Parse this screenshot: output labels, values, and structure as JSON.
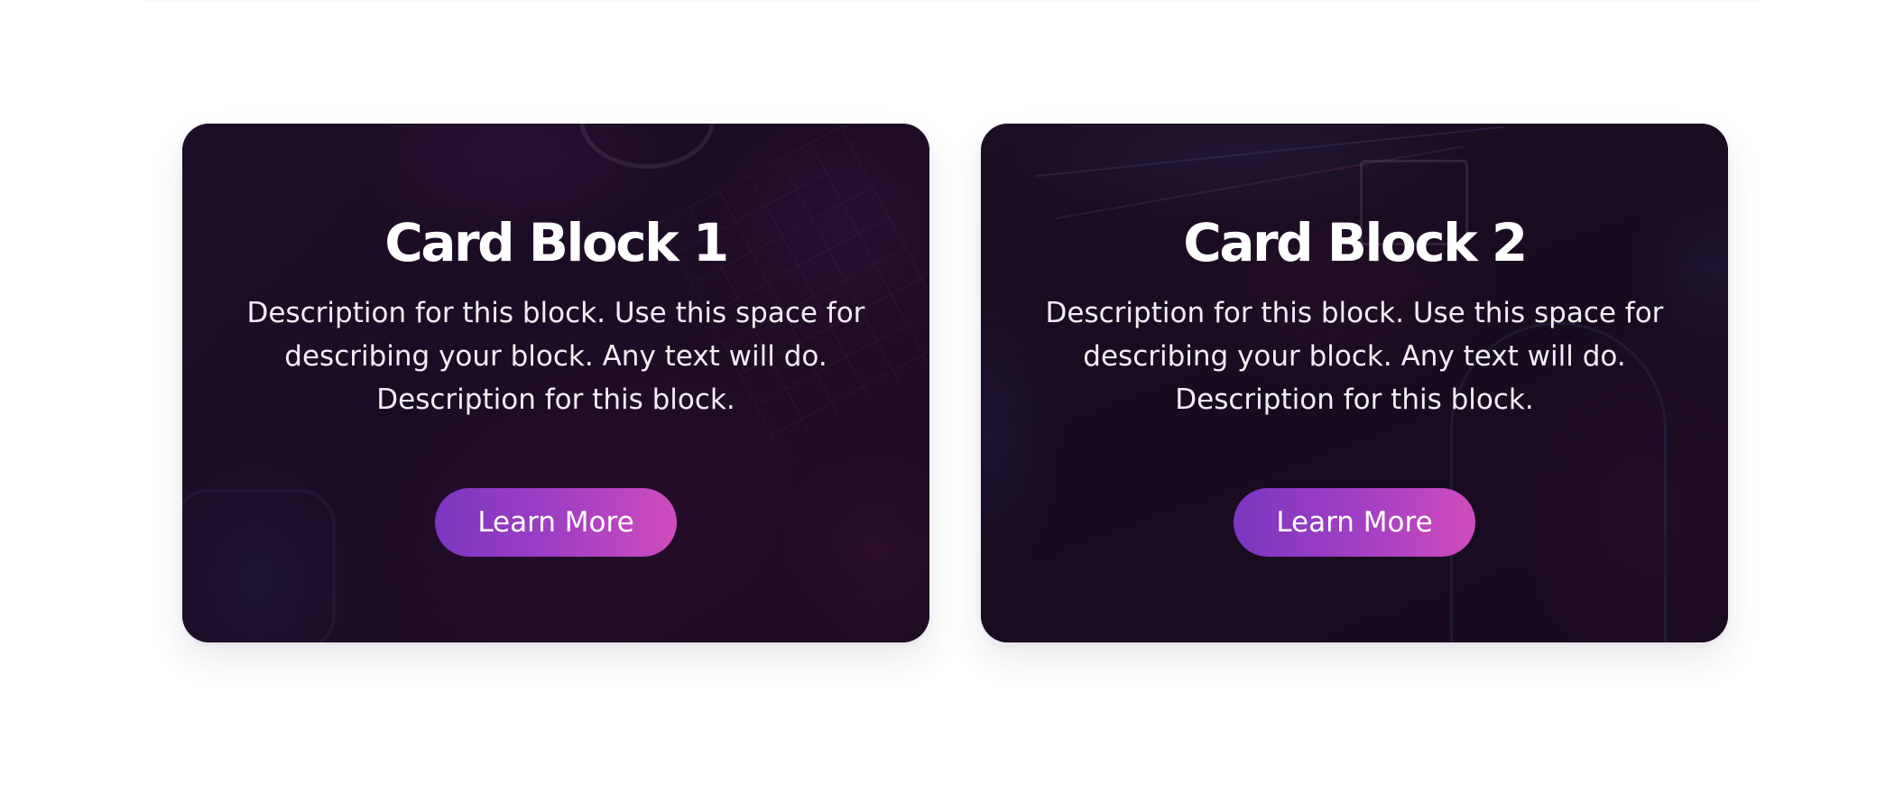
{
  "cards": [
    {
      "title": "Card Block 1",
      "description": "Description for this block. Use this space for describing your block. Any text will do. Description for this block.",
      "button_label": "Learn More"
    },
    {
      "title": "Card Block 2",
      "description": "Description for this block. Use this space for describing your block. Any text will do. Description for this block.",
      "button_label": "Learn More"
    }
  ],
  "colors": {
    "card_overlay": "#1d0e25",
    "button_gradient_start": "#7b36c0",
    "button_gradient_end": "#d04bbd",
    "text": "#ffffff"
  }
}
